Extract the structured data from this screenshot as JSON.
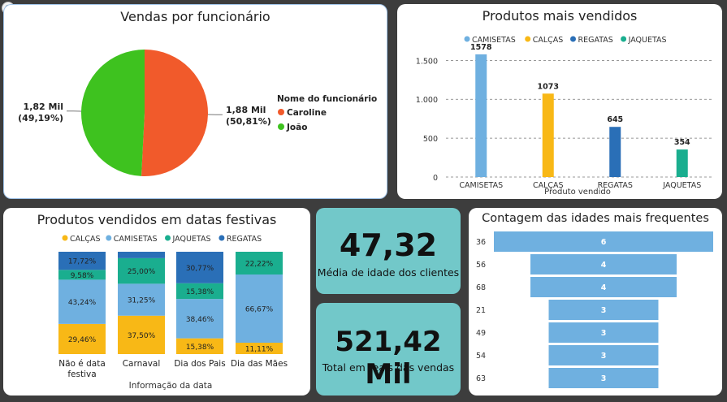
{
  "pie_card": {
    "title": "Vendas por funcionário",
    "legend_title": "Nome do funcionário",
    "chart_data": {
      "type": "pie",
      "slices": [
        {
          "name": "Caroline",
          "value_label": "1,88 Mil",
          "pct_label": "(50,81%)",
          "value": 1.88,
          "pct": 50.81,
          "color": "#f15a2b"
        },
        {
          "name": "João",
          "value_label": "1,82 Mil",
          "pct_label": "(49,19%)",
          "value": 1.82,
          "pct": 49.19,
          "color": "#3ec21f"
        }
      ]
    }
  },
  "bar_card": {
    "title": "Produtos mais vendidos",
    "xlabel": "Produto vendido",
    "chart_data": {
      "type": "bar",
      "categories": [
        "CAMISETAS",
        "CALÇAS",
        "REGATAS",
        "JAQUETAS"
      ],
      "values": [
        1578,
        1073,
        645,
        354
      ],
      "value_labels": [
        "1578",
        "1073",
        "645",
        "354"
      ],
      "colors": [
        "#6fb0e0",
        "#f8b816",
        "#2a6fb7",
        "#1aae8f"
      ],
      "yticks": [
        0,
        500,
        1000,
        1500
      ],
      "ytick_labels": [
        "0",
        "500",
        "1.000",
        "1.500"
      ],
      "ylim": [
        0,
        1650
      ]
    }
  },
  "stack_card": {
    "title": "Produtos vendidos em datas festivas",
    "xlabel": "Informação da data",
    "legend": [
      {
        "name": "CALÇAS",
        "color": "#f8b816"
      },
      {
        "name": "CAMISETAS",
        "color": "#6fb0e0"
      },
      {
        "name": "JAQUETAS",
        "color": "#1aae8f"
      },
      {
        "name": "REGATAS",
        "color": "#2a6fb7"
      }
    ],
    "chart_data": {
      "type": "bar",
      "stacked": "100%",
      "categories": [
        [
          "Não é data",
          "festiva"
        ],
        [
          "Carnaval"
        ],
        [
          "Dia dos Pais"
        ],
        [
          "Dia das Mães"
        ]
      ],
      "series": [
        {
          "name": "CALÇAS",
          "color": "#f8b816",
          "values": [
            29.46,
            37.5,
            15.38,
            11.11
          ],
          "labels": [
            "29,46%",
            "37,50%",
            "15,38%",
            "11,11%"
          ]
        },
        {
          "name": "CAMISETAS",
          "color": "#6fb0e0",
          "values": [
            43.24,
            31.25,
            38.46,
            66.67
          ],
          "labels": [
            "43,24%",
            "31,25%",
            "38,46%",
            "66,67%"
          ]
        },
        {
          "name": "JAQUETAS",
          "color": "#1aae8f",
          "values": [
            9.58,
            25.0,
            15.38,
            22.22
          ],
          "labels": [
            "9,58%",
            "25,00%",
            "15,38%",
            "22,22%"
          ]
        },
        {
          "name": "REGATAS",
          "color": "#2a6fb7",
          "values": [
            17.72,
            6.25,
            30.77,
            0
          ],
          "labels": [
            "17,72%",
            "",
            "30,77%",
            ""
          ]
        }
      ]
    }
  },
  "kpi_age": {
    "value": "47,32",
    "label": "Média de idade dos clientes"
  },
  "kpi_total": {
    "value": "521,42 Mil",
    "label": "Total em reais das vendas"
  },
  "funnel_card": {
    "title": "Contagem das idades mais frequentes",
    "chart_data": {
      "type": "bar",
      "orientation": "funnel",
      "categories": [
        "36",
        "56",
        "68",
        "21",
        "49",
        "54",
        "63"
      ],
      "values": [
        6,
        4,
        4,
        3,
        3,
        3,
        3
      ],
      "value_labels": [
        "6",
        "4",
        "4",
        "3",
        "3",
        "3",
        "3"
      ],
      "color": "#6fb0e0"
    }
  },
  "close_icon_glyph": "⊗"
}
